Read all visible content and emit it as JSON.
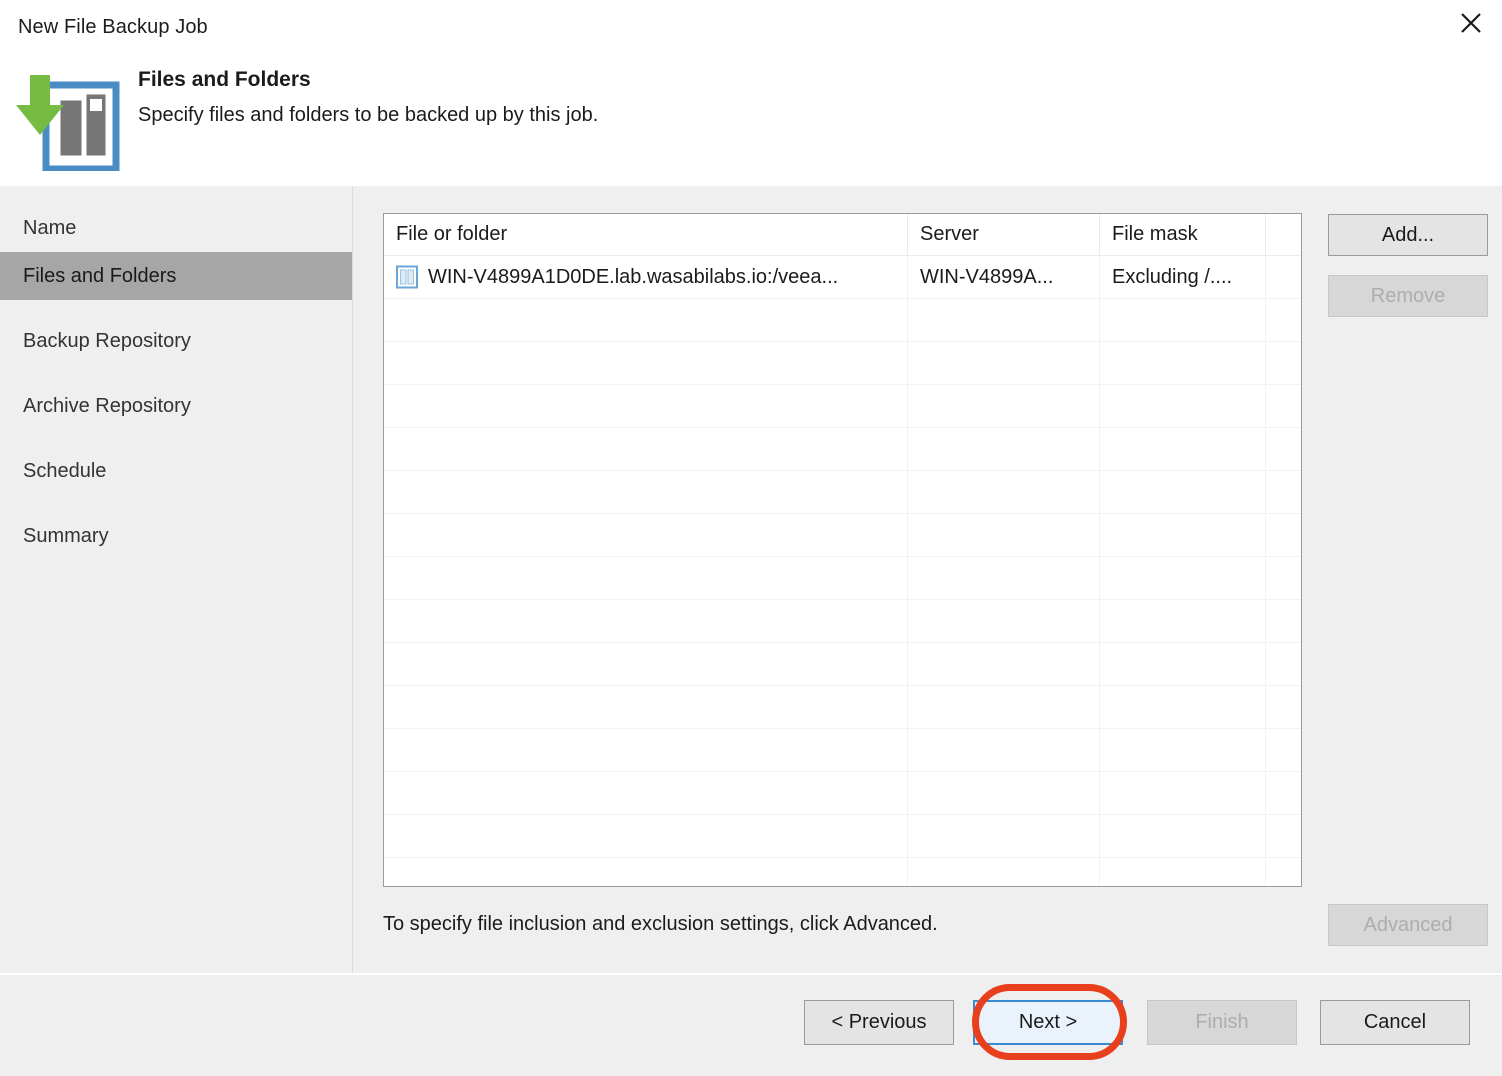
{
  "window": {
    "title": "New File Backup Job",
    "close_icon": "close-icon"
  },
  "header": {
    "icon": "files-and-folders-backup-icon",
    "title": "Files and Folders",
    "subtitle": "Specify files and folders to be backed up by this job."
  },
  "sidebar": {
    "items": [
      {
        "label": "Name",
        "selected": false
      },
      {
        "label": "Files and Folders",
        "selected": true
      },
      {
        "label": "Backup Repository",
        "selected": false
      },
      {
        "label": "Archive Repository",
        "selected": false
      },
      {
        "label": "Schedule",
        "selected": false
      },
      {
        "label": "Summary",
        "selected": false
      }
    ]
  },
  "grid": {
    "columns": [
      "File or folder",
      "Server",
      "File mask",
      ""
    ],
    "rows": [
      {
        "icon": "file-server-icon",
        "file_or_folder": "WIN-V4899A1D0DE.lab.wasabilabs.io:/veea...",
        "server": "WIN-V4899A...",
        "file_mask": "Excluding /....",
        "extra": ""
      }
    ]
  },
  "actions": {
    "add_label": "Add...",
    "remove_label": "Remove",
    "advanced_label": "Advanced",
    "hint": "To specify file inclusion and exclusion settings, click Advanced."
  },
  "footer": {
    "previous_label": "< Previous",
    "next_label": "Next >",
    "finish_label": "Finish",
    "cancel_label": "Cancel"
  },
  "annotation": {
    "shape": "oval-highlight",
    "target": "Next >",
    "color": "#e8401c"
  },
  "colors": {
    "dialog_bg": "#efefef",
    "header_bg": "#ffffff",
    "selected_item_bg": "#a6a6a6",
    "focus_border": "#3a8ad2",
    "icon_green": "#76bc43",
    "icon_blue": "#4a8dc4",
    "icon_gray": "#767676"
  }
}
